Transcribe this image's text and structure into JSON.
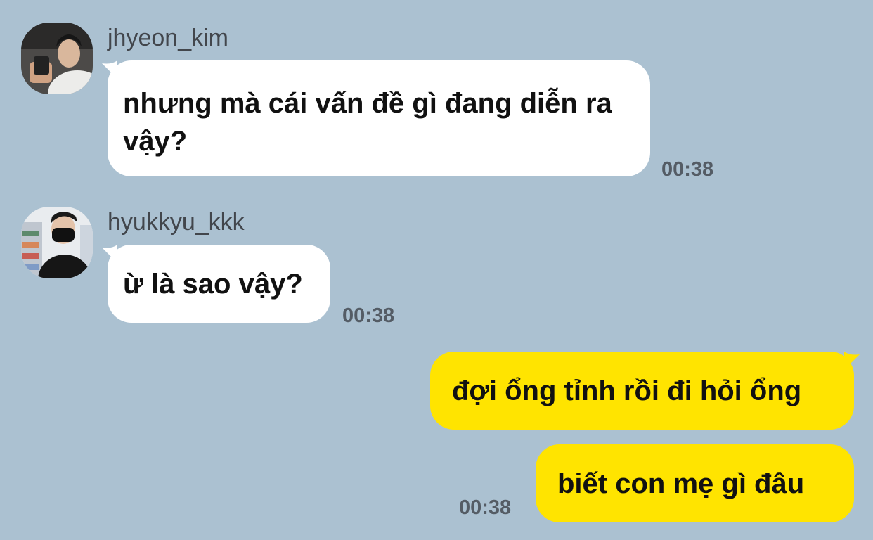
{
  "messages": [
    {
      "sender": "jhyeon_kim",
      "text": "nhưng mà cái vấn đề gì đang diễn ra vậy?",
      "time": "00:38"
    },
    {
      "sender": "hyukkyu_kkk",
      "text": "ừ là sao vậy?",
      "time": "00:38"
    },
    {
      "sender": "me",
      "text": "đợi ổng tỉnh rồi đi hỏi ổng"
    },
    {
      "sender": "me",
      "text": "biết con mẹ gì đâu",
      "time": "00:38"
    }
  ],
  "colors": {
    "background": "#abc1d1",
    "incoming_bubble": "#ffffff",
    "outgoing_bubble": "#ffe400"
  }
}
